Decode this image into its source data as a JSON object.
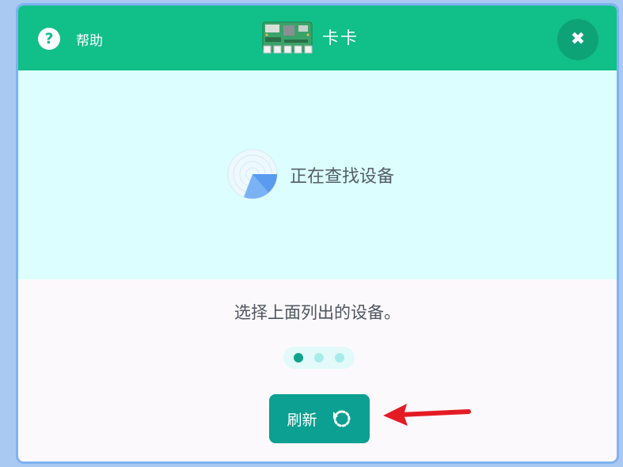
{
  "header": {
    "help_label": "帮助",
    "help_glyph": "?",
    "title": "卡卡",
    "close_glyph": "✖"
  },
  "scan": {
    "status_text": "正在查找设备"
  },
  "main": {
    "instruction": "选择上面列出的设备。",
    "pagination": {
      "count": 3,
      "active_index": 0
    },
    "refresh_label": "刷新"
  },
  "colors": {
    "header_green": "#11bf88",
    "scan_bg": "#dcfefe",
    "button_teal": "#0ba091",
    "arrow_red": "#e31b23"
  }
}
